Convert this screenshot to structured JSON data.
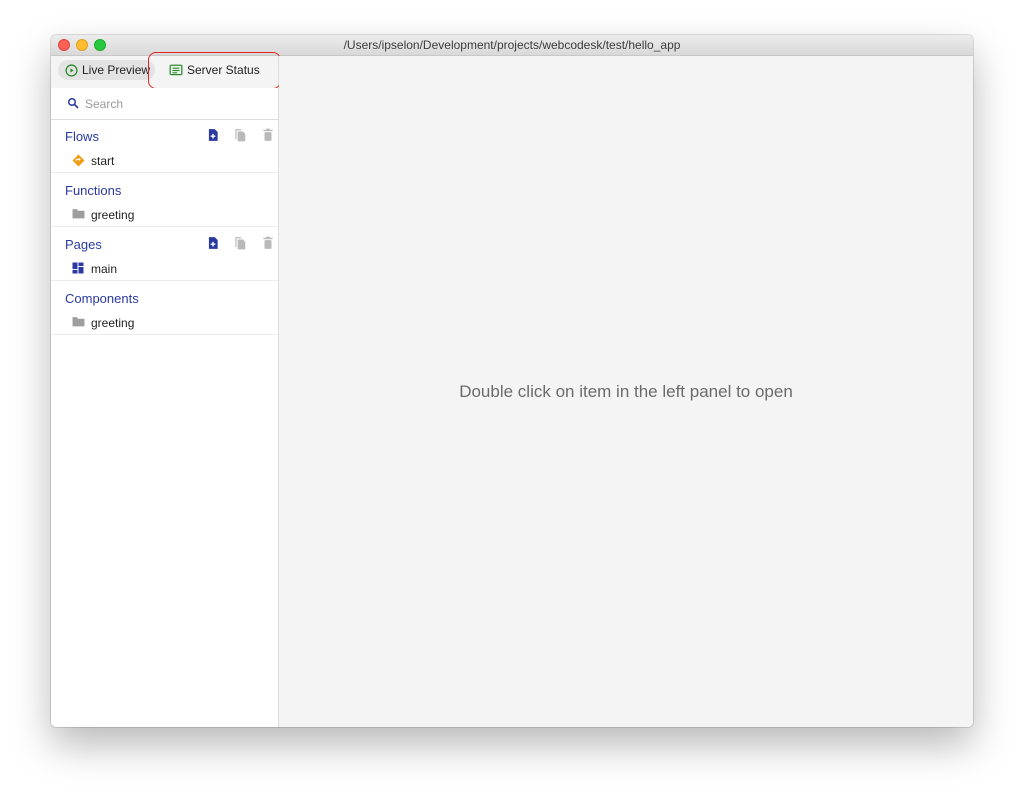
{
  "window": {
    "title": "/Users/ipselon/Development/projects/webcodesk/test/hello_app"
  },
  "toolbar": {
    "live_preview_label": "Live Preview",
    "server_status_label": "Server Status"
  },
  "search": {
    "placeholder": "Search"
  },
  "sections": {
    "flows": {
      "title": "Flows",
      "items": [
        {
          "label": "start",
          "icon": "flow-diamond-icon"
        }
      ]
    },
    "functions": {
      "title": "Functions",
      "items": [
        {
          "label": "greeting",
          "icon": "folder-icon"
        }
      ]
    },
    "pages": {
      "title": "Pages",
      "items": [
        {
          "label": "main",
          "icon": "page-layout-icon"
        }
      ]
    },
    "components": {
      "title": "Components",
      "items": [
        {
          "label": "greeting",
          "icon": "folder-icon"
        }
      ]
    }
  },
  "main": {
    "hint": "Double click on item in the left panel to open"
  },
  "colors": {
    "accent": "#2a3aa0",
    "flow_icon": "#f39c12",
    "server_icon": "#2e8b2e",
    "highlight": "#e02525"
  }
}
